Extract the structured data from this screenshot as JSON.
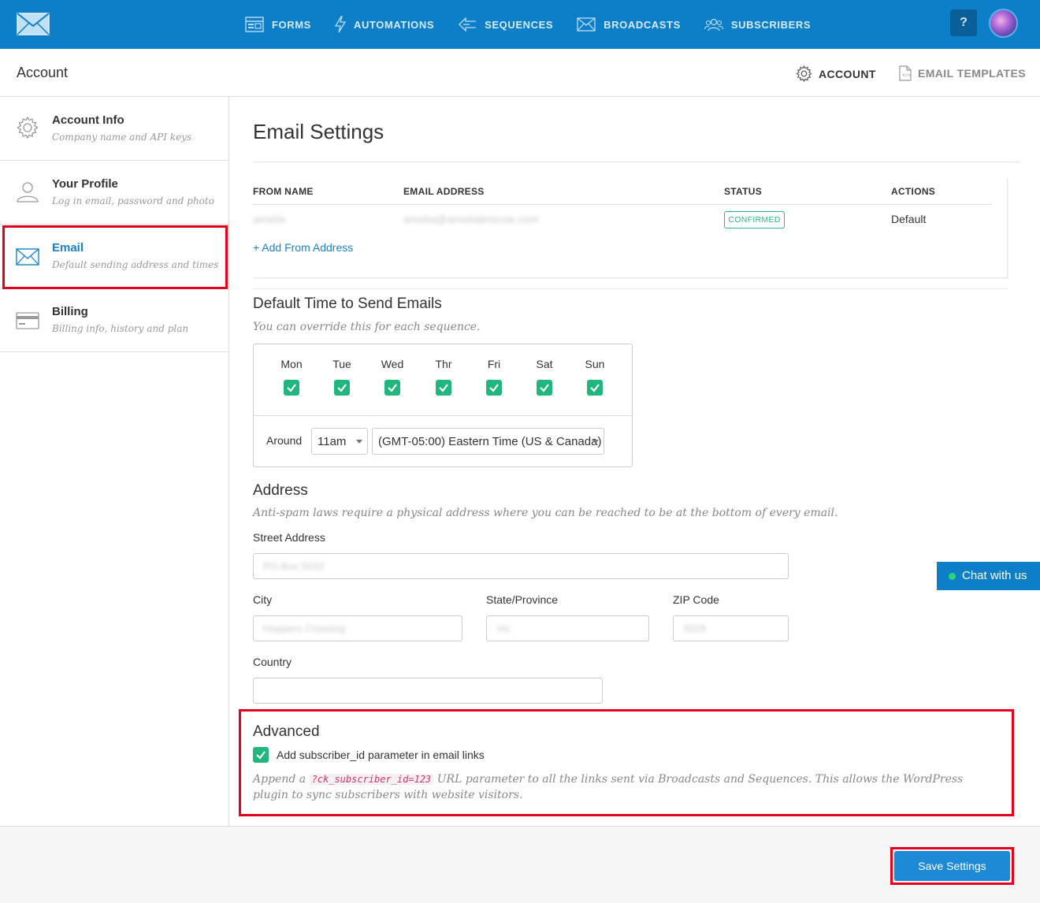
{
  "topnav": {
    "items": [
      {
        "label": "FORMS",
        "icon": "forms-icon"
      },
      {
        "label": "AUTOMATIONS",
        "icon": "lightning-icon"
      },
      {
        "label": "SEQUENCES",
        "icon": "sequences-icon"
      },
      {
        "label": "BROADCASTS",
        "icon": "envelope-icon"
      },
      {
        "label": "SUBSCRIBERS",
        "icon": "users-icon"
      }
    ],
    "help_label": "?"
  },
  "subheader": {
    "title": "Account",
    "account_link": "ACCOUNT",
    "templates_link": "EMAIL TEMPLATES"
  },
  "sidebar": {
    "items": [
      {
        "label": "Account Info",
        "sub": "Company name and API keys"
      },
      {
        "label": "Your Profile",
        "sub": "Log in email, password and photo"
      },
      {
        "label": "Email",
        "sub": "Default sending address and times"
      },
      {
        "label": "Billing",
        "sub": "Billing info, history and plan"
      }
    ]
  },
  "main": {
    "title": "Email Settings",
    "table": {
      "headers": [
        "FROM NAME",
        "EMAIL ADDRESS",
        "STATUS",
        "ACTIONS"
      ],
      "row": {
        "from_name": "amelia",
        "email": "amelia@ameliabriscoe.com",
        "status": "CONFIRMED",
        "action": "Default"
      },
      "add_link": "+ Add From Address"
    },
    "send_time": {
      "title": "Default Time to Send Emails",
      "hint": "You can override this for each sequence.",
      "days": [
        "Mon",
        "Tue",
        "Wed",
        "Thr",
        "Fri",
        "Sat",
        "Sun"
      ],
      "around_label": "Around",
      "time_value": "11am",
      "timezone_value": "(GMT-05:00) Eastern Time (US & Canada)"
    },
    "address": {
      "title": "Address",
      "hint": "Anti-spam laws require a physical address where you can be reached to be at the bottom of every email.",
      "street_label": "Street Address",
      "street_value": "PO Box 5032",
      "city_label": "City",
      "city_value": "Hoppers Crossing",
      "state_label": "State/Province",
      "state_value": "Vic",
      "zip_label": "ZIP Code",
      "zip_value": "3029",
      "country_label": "Country",
      "country_value": ""
    },
    "advanced": {
      "title": "Advanced",
      "checkbox_label": "Add subscriber_id parameter in email links",
      "hint_before": "Append a",
      "hint_code": "?ck_subscriber_id=123",
      "hint_after": "URL parameter to all the links sent via Broadcasts and Sequences. This allows the WordPress plugin to sync subscribers with website visitors."
    }
  },
  "chat_label": "Chat with us",
  "save_label": "Save Settings",
  "colors": {
    "brand": "#0d7fc9",
    "success": "#21b67d",
    "highlight": "#e3001b"
  }
}
